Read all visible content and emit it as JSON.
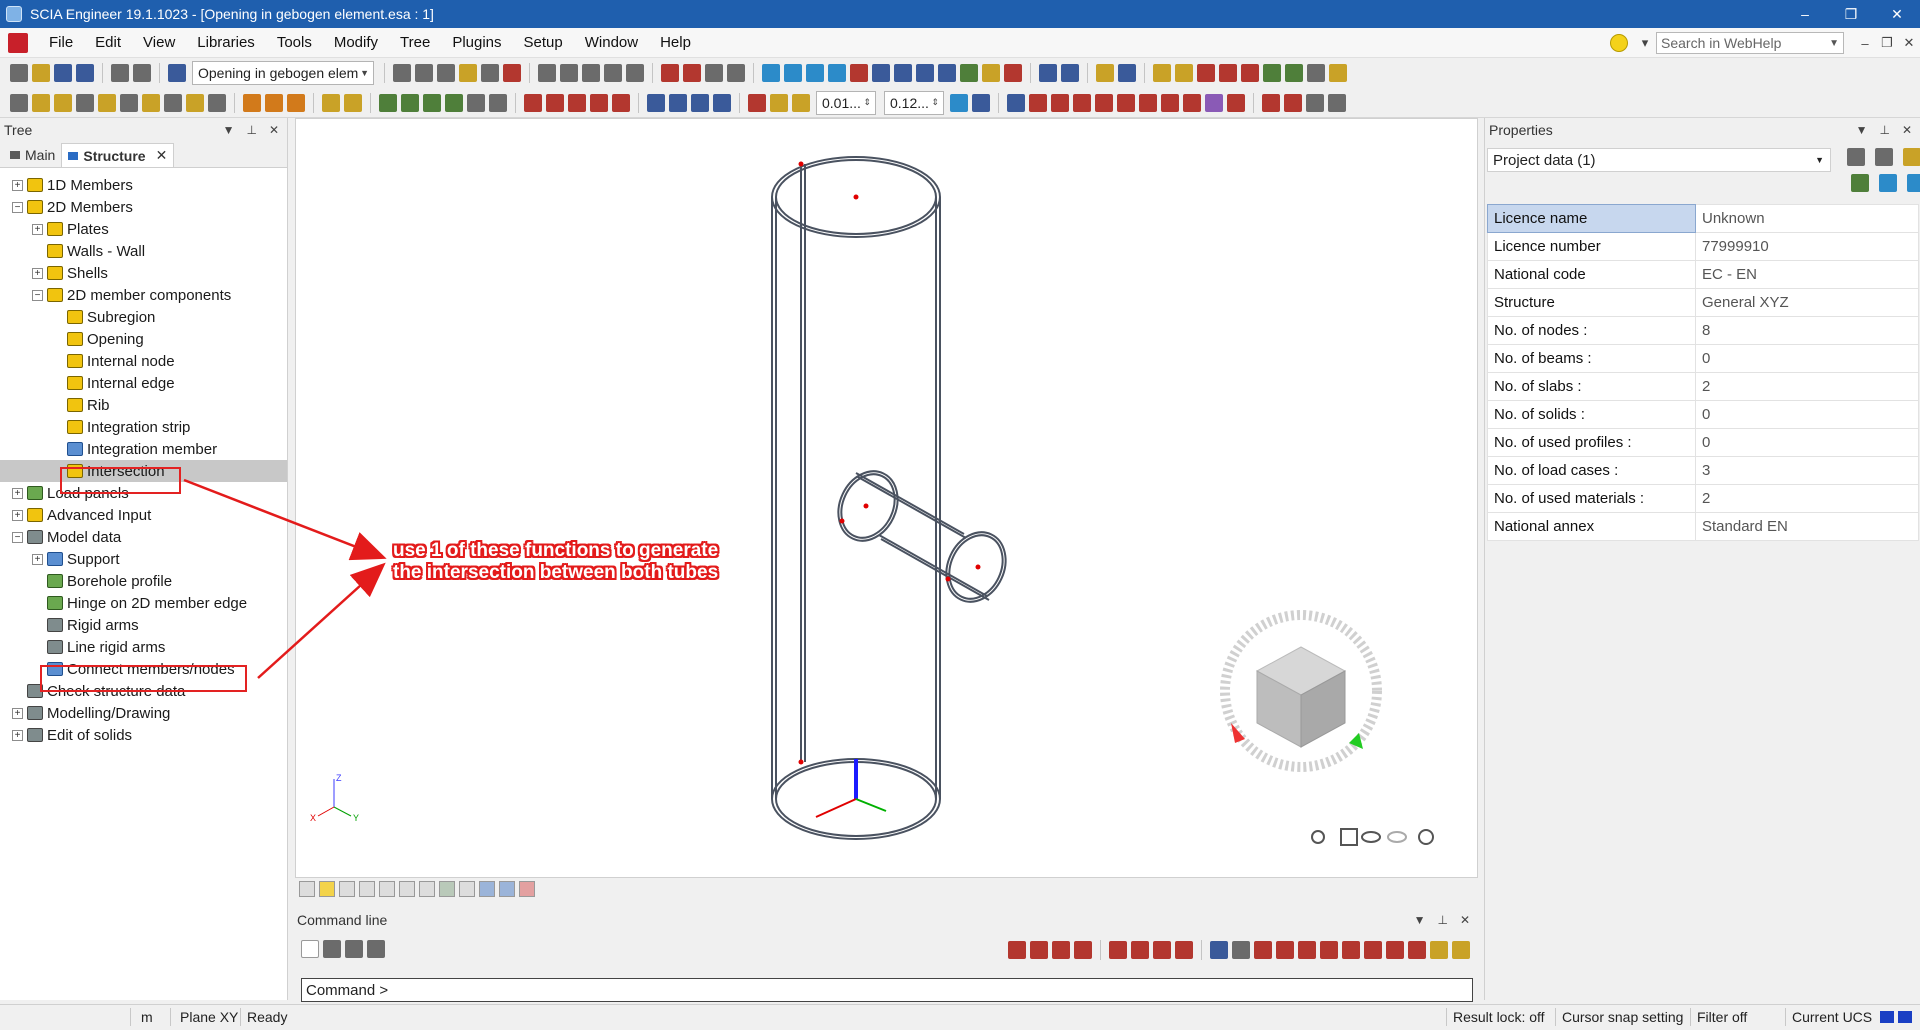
{
  "window": {
    "title": "SCIA Engineer 19.1.1023 - [Opening in gebogen element.esa : 1]",
    "controls": [
      "–",
      "❐",
      "✕"
    ]
  },
  "menubar": {
    "items": [
      "File",
      "Edit",
      "View",
      "Libraries",
      "Tools",
      "Modify",
      "Tree",
      "Plugins",
      "Setup",
      "Window",
      "Help"
    ],
    "search_placeholder": "Search in WebHelp",
    "mdi_controls": [
      "–",
      "❐",
      "✕"
    ]
  },
  "toolbar": {
    "project_combo": "Opening in gebogen elem",
    "spin1": "0.01...",
    "spin2": "0.12..."
  },
  "tree": {
    "panel_title": "Tree",
    "panel_controls": [
      "▼",
      "📌",
      "✕"
    ],
    "tabs": [
      {
        "label": "Main",
        "active": false
      },
      {
        "label": "Structure",
        "active": true
      }
    ],
    "items": [
      {
        "label": "1D Members",
        "level": 0,
        "expander": "+",
        "icon": "1d-members-icon"
      },
      {
        "label": "2D Members",
        "level": 0,
        "expander": "−",
        "icon": "2d-members-icon"
      },
      {
        "label": "Plates",
        "level": 1,
        "expander": "+",
        "icon": "plates-icon"
      },
      {
        "label": "Walls - Wall",
        "level": 1,
        "expander": "",
        "icon": "walls-icon"
      },
      {
        "label": "Shells",
        "level": 1,
        "expander": "+",
        "icon": "shells-icon"
      },
      {
        "label": "2D member components",
        "level": 1,
        "expander": "−",
        "icon": "components-icon"
      },
      {
        "label": "Subregion",
        "level": 2,
        "expander": "",
        "icon": "subregion-icon"
      },
      {
        "label": "Opening",
        "level": 2,
        "expander": "",
        "icon": "opening-icon"
      },
      {
        "label": "Internal node",
        "level": 2,
        "expander": "",
        "icon": "internal-node-icon"
      },
      {
        "label": "Internal edge",
        "level": 2,
        "expander": "",
        "icon": "internal-edge-icon"
      },
      {
        "label": "Rib",
        "level": 2,
        "expander": "",
        "icon": "rib-icon"
      },
      {
        "label": "Integration strip",
        "level": 2,
        "expander": "",
        "icon": "integration-strip-icon"
      },
      {
        "label": "Integration member",
        "level": 2,
        "expander": "",
        "icon": "integration-member-icon"
      },
      {
        "label": "Intersection",
        "level": 2,
        "expander": "",
        "icon": "intersection-icon",
        "selected": true
      },
      {
        "label": "Load panels",
        "level": 0,
        "expander": "+",
        "icon": "load-panels-icon"
      },
      {
        "label": "Advanced Input",
        "level": 0,
        "expander": "+",
        "icon": "advanced-input-icon"
      },
      {
        "label": "Model data",
        "level": 0,
        "expander": "−",
        "icon": "model-data-icon"
      },
      {
        "label": "Support",
        "level": 1,
        "expander": "+",
        "icon": "support-icon"
      },
      {
        "label": "Borehole profile",
        "level": 1,
        "expander": "",
        "icon": "borehole-icon"
      },
      {
        "label": "Hinge on 2D member edge",
        "level": 1,
        "expander": "",
        "icon": "hinge-icon"
      },
      {
        "label": "Rigid arms",
        "level": 1,
        "expander": "",
        "icon": "rigid-arms-icon"
      },
      {
        "label": "Line rigid arms",
        "level": 1,
        "expander": "",
        "icon": "line-rigid-arms-icon"
      },
      {
        "label": "Connect members/nodes",
        "level": 1,
        "expander": "",
        "icon": "connect-icon"
      },
      {
        "label": "Check structure data",
        "level": 0,
        "expander": "",
        "icon": "check-icon"
      },
      {
        "label": "Modelling/Drawing",
        "level": 0,
        "expander": "+",
        "icon": "modelling-icon"
      },
      {
        "label": "Edit of solids",
        "level": 0,
        "expander": "+",
        "icon": "solids-icon"
      }
    ]
  },
  "annotation": {
    "line1": "use 1 of these functions to generate",
    "line2": "the intersection between both tubes",
    "color": "#e31b1b"
  },
  "viewport": {
    "axis_labels": {
      "z": "Z",
      "x": "X",
      "y": "Y"
    }
  },
  "command_line": {
    "title": "Command line",
    "prompt": "Command >"
  },
  "properties": {
    "title": "Properties",
    "combo_value": "Project data (1)",
    "rows": [
      {
        "key": "Licence name",
        "value": "Unknown"
      },
      {
        "key": "Licence number",
        "value": "77999910"
      },
      {
        "key": "National code",
        "value": "EC - EN"
      },
      {
        "key": "Structure",
        "value": "General XYZ"
      },
      {
        "key": "No. of nodes :",
        "value": "8"
      },
      {
        "key": "No. of beams :",
        "value": "0"
      },
      {
        "key": "No. of slabs :",
        "value": "2"
      },
      {
        "key": "No. of solids :",
        "value": "0"
      },
      {
        "key": "No. of used profiles :",
        "value": "0"
      },
      {
        "key": "No. of load cases :",
        "value": "3"
      },
      {
        "key": "No. of used materials :",
        "value": "2"
      },
      {
        "key": "National annex",
        "value": "Standard EN"
      }
    ]
  },
  "statusbar": {
    "unit": "m",
    "plane": "Plane XY",
    "state": "Ready",
    "result_lock": "Result lock: off",
    "cursor_snap": "Cursor snap setting",
    "filter": "Filter off",
    "ucs": "Current UCS"
  }
}
